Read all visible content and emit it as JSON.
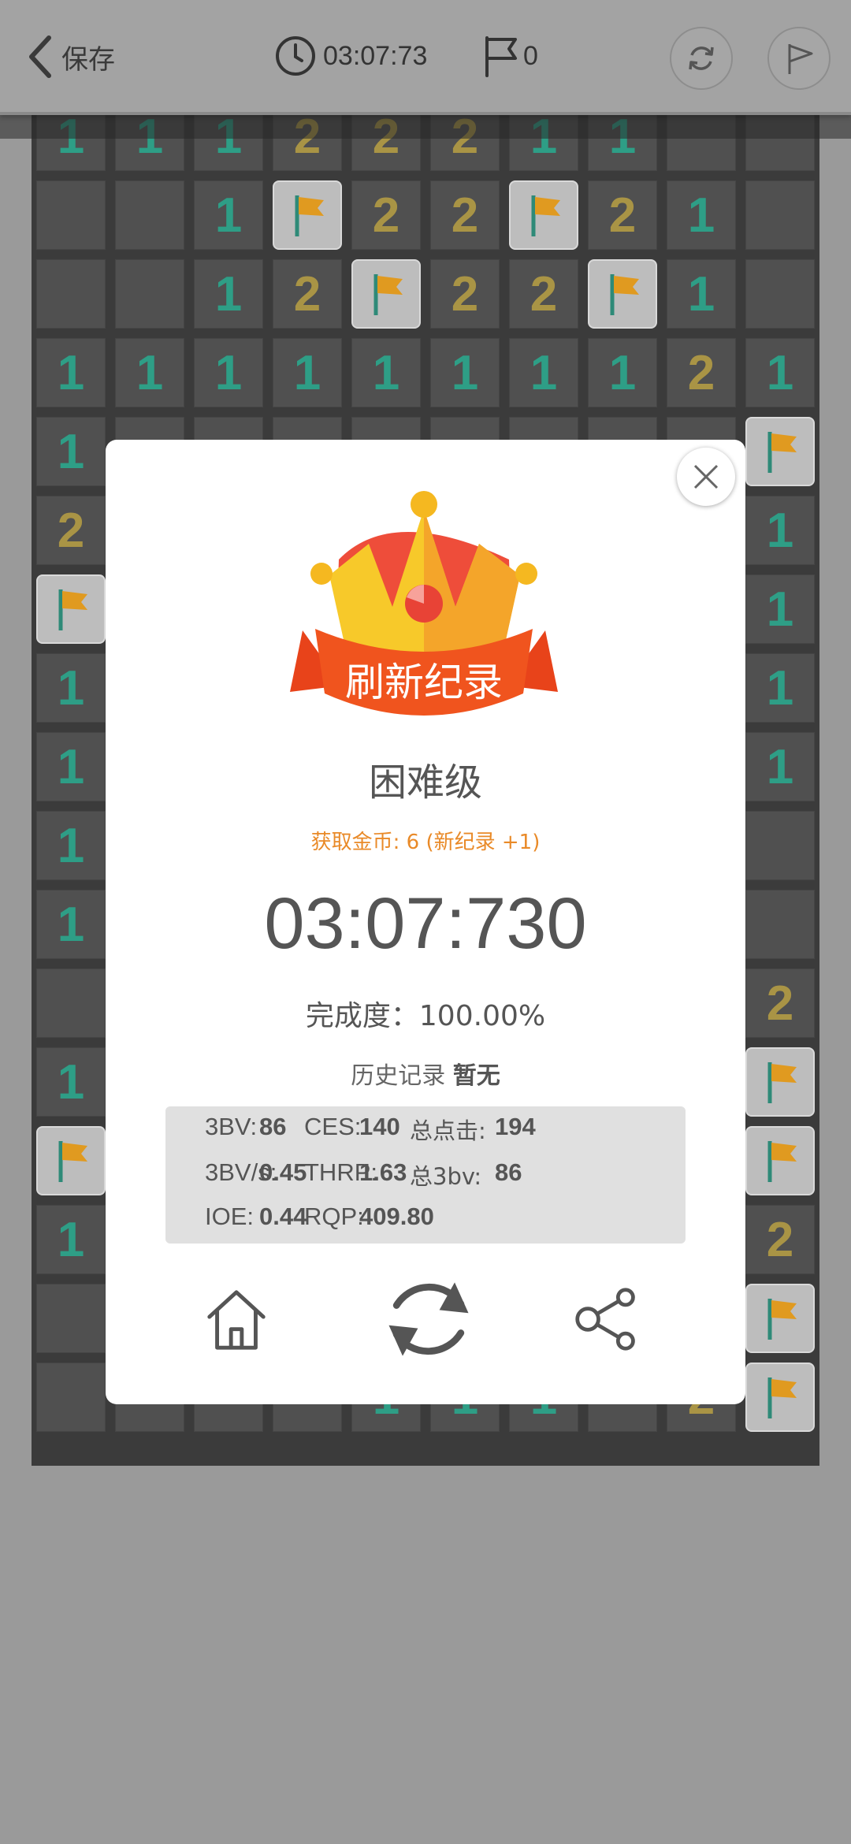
{
  "topbar": {
    "back_label": "保存",
    "timer": "03:07:73",
    "flag_count": "0"
  },
  "board": {
    "rows": [
      [
        "1",
        "1",
        "1",
        "2",
        "2",
        "2",
        "1",
        "1",
        "",
        ""
      ],
      [
        "",
        "",
        "1",
        "F",
        "2",
        "2",
        "F",
        "2",
        "1",
        ""
      ],
      [
        "",
        "",
        "1",
        "2",
        "F",
        "2",
        "2",
        "F",
        "1",
        ""
      ],
      [
        "1",
        "1",
        "1",
        "1",
        "1",
        "1",
        "1",
        "1",
        "2",
        "1"
      ],
      [
        "1",
        "",
        "",
        "",
        "",
        "",
        "",
        "",
        "",
        "F"
      ],
      [
        "2",
        "",
        "",
        "",
        "",
        "",
        "",
        "",
        "",
        "1"
      ],
      [
        "F",
        "",
        "",
        "",
        "",
        "",
        "",
        "",
        "",
        "1"
      ],
      [
        "1",
        "",
        "",
        "",
        "",
        "",
        "",
        "",
        "",
        "1"
      ],
      [
        "1",
        "",
        "",
        "",
        "",
        "",
        "",
        "",
        "",
        "1"
      ],
      [
        "1",
        "",
        "",
        "",
        "",
        "",
        "",
        "",
        "",
        ""
      ],
      [
        "1",
        "",
        "",
        "",
        "",
        "",
        "",
        "",
        "",
        ""
      ],
      [
        "",
        "",
        "",
        "",
        "",
        "",
        "",
        "",
        "",
        "2"
      ],
      [
        "1",
        "",
        "",
        "",
        "",
        "",
        "",
        "",
        "",
        "F"
      ],
      [
        "F",
        "",
        "",
        "",
        "",
        "",
        "",
        "",
        "",
        "F"
      ],
      [
        "1",
        "",
        "",
        "",
        "",
        "",
        "",
        "",
        "",
        "2"
      ],
      [
        "",
        "",
        "",
        "",
        "",
        "",
        "",
        "",
        "",
        "F"
      ],
      [
        "",
        "",
        "",
        "",
        "1",
        "1",
        "1",
        "",
        "2",
        "F"
      ]
    ],
    "colors": {
      "one": "#2e9e86",
      "two": "#a99445",
      "flag": "#e09a20"
    }
  },
  "modal": {
    "banner": "刷新纪录",
    "level": "困难级",
    "coins": "获取金币: 6 (新纪录 +1)",
    "time": "03:07:730",
    "completion": "完成度：100.00%",
    "history_label": "历史记录",
    "history_value": "暂无",
    "stats": {
      "bv_label": "3BV:",
      "bv": "86",
      "ces_label": "CES:",
      "ces": "140",
      "clicks_label": "总点击:",
      "clicks": "194",
      "bvs_label": "3BV/s:",
      "bvs": "0.45",
      "thrp_label": "THRP:",
      "thrp": "1.63",
      "total3bv_label": "总3bv:",
      "total3bv": "86",
      "ioe_label": "IOE:",
      "ioe": "0.44",
      "rqp_label": "RQP:",
      "rqp": "409.80"
    }
  },
  "colors": {
    "accent": "#e98a28",
    "banner": "#e8431a",
    "crown": "#f5b820"
  }
}
